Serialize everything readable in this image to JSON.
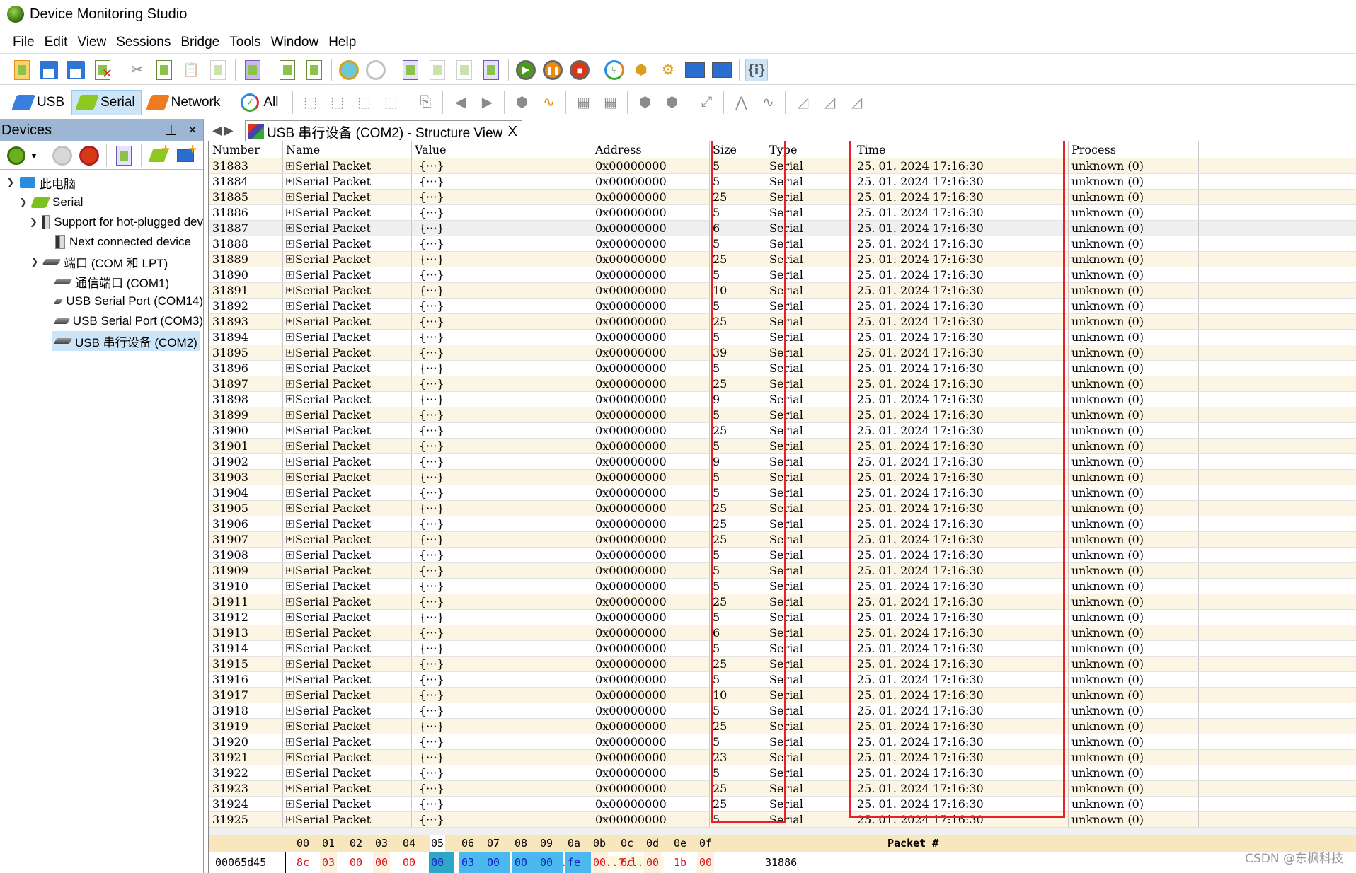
{
  "window": {
    "title": "Device Monitoring Studio"
  },
  "menu": [
    "File",
    "Edit",
    "View",
    "Sessions",
    "Bridge",
    "Tools",
    "Window",
    "Help"
  ],
  "toolbar_secondary": {
    "tabs": [
      {
        "label": "USB",
        "selected": false
      },
      {
        "label": "Serial",
        "selected": true
      },
      {
        "label": "Network",
        "selected": false
      },
      {
        "label": "All",
        "selected": false
      }
    ]
  },
  "devices_panel": {
    "title": "Devices",
    "pin_label": "⊥",
    "close_label": "×",
    "tree": [
      {
        "label": "此电脑",
        "level": 0,
        "expanded": true,
        "icon": "computer-icon"
      },
      {
        "label": "Serial",
        "level": 1,
        "expanded": true,
        "icon": "serial-icon"
      },
      {
        "label": "Support for hot-plugged dev",
        "level": 2,
        "expanded": true,
        "icon": "device-unknown-icon"
      },
      {
        "label": "Next connected device",
        "level": 3,
        "expanded": null,
        "icon": "device-unknown-icon"
      },
      {
        "label": "端口 (COM 和 LPT)",
        "level": 2,
        "expanded": true,
        "icon": "port-icon"
      },
      {
        "label": "通信端口 (COM1)",
        "level": 3,
        "expanded": null,
        "icon": "port-icon"
      },
      {
        "label": "USB Serial Port (COM14)",
        "level": 3,
        "expanded": null,
        "icon": "port-icon"
      },
      {
        "label": "USB Serial Port (COM3)",
        "level": 3,
        "expanded": null,
        "icon": "port-icon"
      },
      {
        "label": "USB 串行设备 (COM2)",
        "level": 3,
        "expanded": null,
        "icon": "port-icon",
        "selected": true
      }
    ]
  },
  "document_tab": {
    "label": "USB 串行设备 (COM2) - Structure View",
    "close_label": "X"
  },
  "table": {
    "columns": [
      "Number",
      "Name",
      "Value",
      "Address",
      "Size",
      "Type",
      "Time",
      "Process"
    ],
    "common": {
      "name": "Serial Packet",
      "value": "{···}",
      "address": "0x00000000",
      "type": "Serial",
      "time": "25. 01. 2024 17:16:30",
      "process": "unknown  (0)"
    },
    "rows": [
      {
        "number": "31883",
        "size": "5"
      },
      {
        "number": "31884",
        "size": "5"
      },
      {
        "number": "31885",
        "size": "25"
      },
      {
        "number": "31886",
        "size": "5"
      },
      {
        "number": "31887",
        "size": "6",
        "highlighted": true
      },
      {
        "number": "31888",
        "size": "5"
      },
      {
        "number": "31889",
        "size": "25"
      },
      {
        "number": "31890",
        "size": "5"
      },
      {
        "number": "31891",
        "size": "10"
      },
      {
        "number": "31892",
        "size": "5"
      },
      {
        "number": "31893",
        "size": "25"
      },
      {
        "number": "31894",
        "size": "5"
      },
      {
        "number": "31895",
        "size": "39"
      },
      {
        "number": "31896",
        "size": "5"
      },
      {
        "number": "31897",
        "size": "25"
      },
      {
        "number": "31898",
        "size": "9"
      },
      {
        "number": "31899",
        "size": "5"
      },
      {
        "number": "31900",
        "size": "25"
      },
      {
        "number": "31901",
        "size": "5"
      },
      {
        "number": "31902",
        "size": "9"
      },
      {
        "number": "31903",
        "size": "5"
      },
      {
        "number": "31904",
        "size": "5"
      },
      {
        "number": "31905",
        "size": "25"
      },
      {
        "number": "31906",
        "size": "25"
      },
      {
        "number": "31907",
        "size": "25"
      },
      {
        "number": "31908",
        "size": "5"
      },
      {
        "number": "31909",
        "size": "5"
      },
      {
        "number": "31910",
        "size": "5"
      },
      {
        "number": "31911",
        "size": "25"
      },
      {
        "number": "31912",
        "size": "5"
      },
      {
        "number": "31913",
        "size": "6"
      },
      {
        "number": "31914",
        "size": "5"
      },
      {
        "number": "31915",
        "size": "25"
      },
      {
        "number": "31916",
        "size": "5"
      },
      {
        "number": "31917",
        "size": "10"
      },
      {
        "number": "31918",
        "size": "5"
      },
      {
        "number": "31919",
        "size": "25"
      },
      {
        "number": "31920",
        "size": "5"
      },
      {
        "number": "31921",
        "size": "23"
      },
      {
        "number": "31922",
        "size": "5"
      },
      {
        "number": "31923",
        "size": "25"
      },
      {
        "number": "31924",
        "size": "25"
      },
      {
        "number": "31925",
        "size": "5"
      }
    ]
  },
  "hex_view": {
    "offsets": [
      "00",
      "01",
      "02",
      "03",
      "04",
      "05",
      "06",
      "07",
      "08",
      "09",
      "0a",
      "0b",
      "0c",
      "0d",
      "0e",
      "0f"
    ],
    "packet_header": "Packet #",
    "row": {
      "address": "00065d45",
      "bytes": [
        "8c",
        "03",
        "00",
        "00",
        "00",
        "00",
        "03",
        "00",
        "00",
        "00",
        "fe",
        "00",
        "6c",
        "00",
        "1b",
        "00"
      ],
      "selected_range": [
        5,
        10
      ],
      "ascii": "?.........?.l....",
      "packet": "31886"
    },
    "colors": {
      "byte_normal": "#e0101a",
      "byte_selected": "#1020c0",
      "selection_bg": "#4cb8f0",
      "header_bg": "#f8e6bd"
    }
  },
  "annotations": {
    "color": "#e8202a"
  },
  "watermark": "CSDN @东枫科技"
}
